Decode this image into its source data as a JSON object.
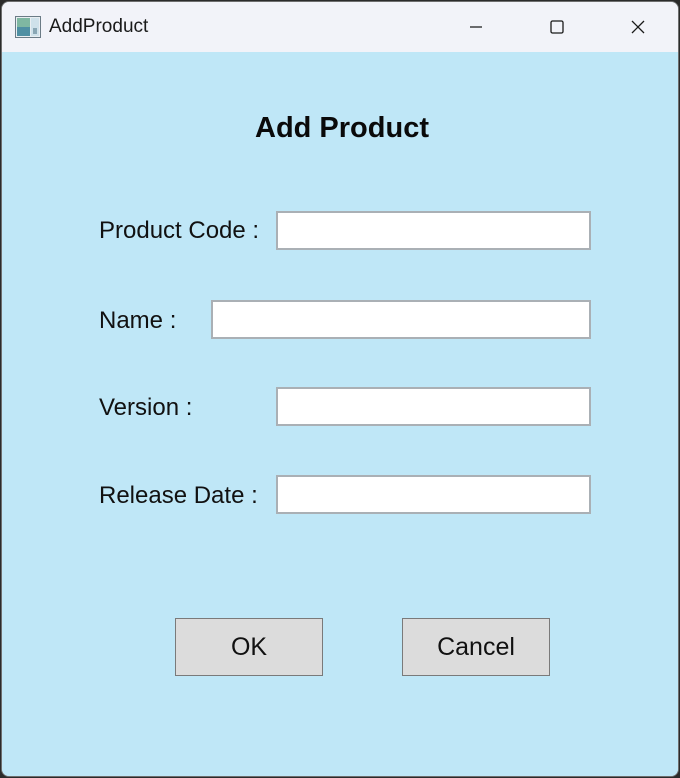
{
  "window": {
    "title": "AddProduct",
    "icon": "app-window-icon",
    "controls": {
      "minimize_icon": "minimize-icon",
      "maximize_icon": "maximize-icon",
      "close_icon": "close-icon"
    }
  },
  "form": {
    "heading": "Add Product",
    "fields": [
      {
        "label": "Product Code :",
        "value": ""
      },
      {
        "label": "Name :",
        "value": ""
      },
      {
        "label": "Version :",
        "value": ""
      },
      {
        "label": "Release Date :",
        "value": ""
      }
    ],
    "buttons": {
      "ok_label": "OK",
      "cancel_label": "Cancel"
    }
  },
  "colors": {
    "client_background": "#bfe7f7",
    "titlebar_background": "#f2f3f9",
    "button_background": "#dcdcdc",
    "field_border": "#aab0b5"
  }
}
